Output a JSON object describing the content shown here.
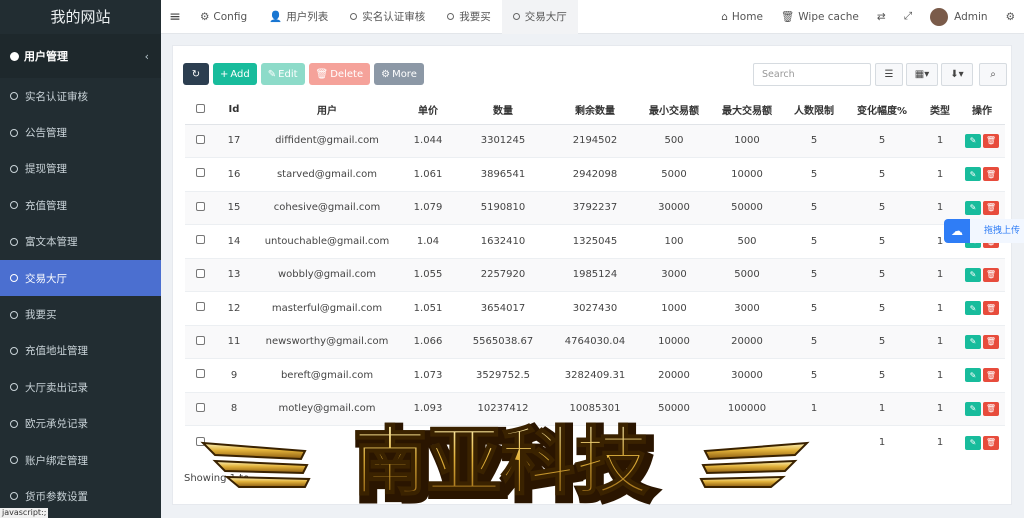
{
  "brand": "我的网站",
  "sidebar": {
    "group_label": "用户管理",
    "collapse_icon": "‹",
    "items": [
      {
        "label": "实名认证审核",
        "active": false
      },
      {
        "label": "公告管理",
        "active": false
      },
      {
        "label": "提现管理",
        "active": false
      },
      {
        "label": "充值管理",
        "active": false
      },
      {
        "label": "富文本管理",
        "active": false
      },
      {
        "label": "交易大厅",
        "active": true
      },
      {
        "label": "我要买",
        "active": false
      },
      {
        "label": "充值地址管理",
        "active": false
      },
      {
        "label": "大厅卖出记录",
        "active": false
      },
      {
        "label": "欧元承兑记录",
        "active": false
      },
      {
        "label": "账户绑定管理",
        "active": false
      },
      {
        "label": "货币参数设置",
        "active": false
      }
    ]
  },
  "topnav": {
    "tabs": [
      {
        "label": "Config",
        "icon": "gear-icon"
      },
      {
        "label": "用户列表",
        "icon": "users-icon"
      },
      {
        "label": "实名认证审核",
        "icon": "circle-icon"
      },
      {
        "label": "我要买",
        "icon": "circle-icon"
      },
      {
        "label": "交易大厅",
        "icon": "circle-icon"
      }
    ],
    "home_label": "Home",
    "wipe_label": "Wipe cache",
    "admin_label": "Admin"
  },
  "toolbar": {
    "add_label": "Add",
    "edit_label": "Edit",
    "delete_label": "Delete",
    "more_label": "More"
  },
  "search": {
    "placeholder": "Search"
  },
  "table": {
    "headers": [
      "Id",
      "用户",
      "单价",
      "数量",
      "剩余数量",
      "最小交易额",
      "最大交易额",
      "人数限制",
      "变化幅度%",
      "类型",
      "操作"
    ],
    "rows": [
      [
        "17",
        "diffident@gmail.com",
        "1.044",
        "3301245",
        "2194502",
        "500",
        "1000",
        "5",
        "5",
        "1"
      ],
      [
        "16",
        "starved@gmail.com",
        "1.061",
        "3896541",
        "2942098",
        "5000",
        "10000",
        "5",
        "5",
        "1"
      ],
      [
        "15",
        "cohesive@gmail.com",
        "1.079",
        "5190810",
        "3792237",
        "30000",
        "50000",
        "5",
        "5",
        "1"
      ],
      [
        "14",
        "untouchable@gmail.com",
        "1.04",
        "1632410",
        "1325045",
        "100",
        "500",
        "5",
        "5",
        "1"
      ],
      [
        "13",
        "wobbly@gmail.com",
        "1.055",
        "2257920",
        "1985124",
        "3000",
        "5000",
        "5",
        "5",
        "1"
      ],
      [
        "12",
        "masterful@gmail.com",
        "1.051",
        "3654017",
        "3027430",
        "1000",
        "3000",
        "5",
        "5",
        "1"
      ],
      [
        "11",
        "newsworthy@gmail.com",
        "1.066",
        "5565038.67",
        "4764030.04",
        "10000",
        "20000",
        "5",
        "5",
        "1"
      ],
      [
        "9",
        "bereft@gmail.com",
        "1.073",
        "3529752.5",
        "3282409.31",
        "20000",
        "30000",
        "5",
        "5",
        "1"
      ],
      [
        "8",
        "motley@gmail.com",
        "1.093",
        "10237412",
        "10085301",
        "50000",
        "100000",
        "1",
        "1",
        "1"
      ],
      [
        "",
        "",
        "",
        "",
        "",
        "",
        "",
        "",
        "1",
        "1"
      ]
    ]
  },
  "showing_text": "Showing 1 to",
  "float_widget": {
    "label": "拖拽上传"
  },
  "watermark": {
    "text": "南亚科技"
  },
  "status_text": "javascript:;",
  "colors": {
    "sidebar_bg": "#222d32",
    "active_item": "#4b6fd0",
    "add_green": "#18bc9c",
    "delete_red": "#e74c3c",
    "refresh_dark": "#2c3e50"
  }
}
